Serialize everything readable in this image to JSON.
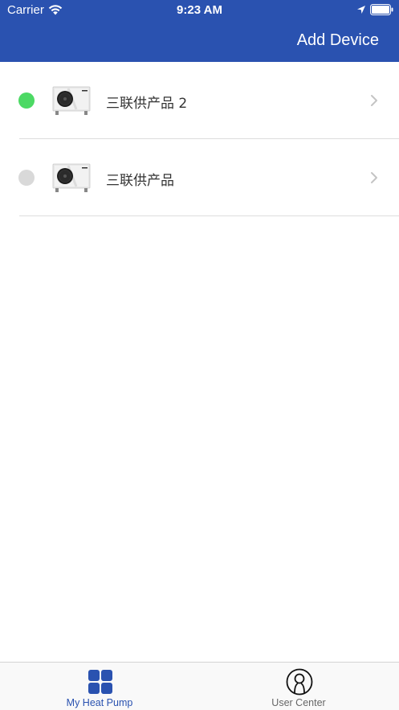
{
  "status_bar": {
    "carrier": "Carrier",
    "time": "9:23 AM"
  },
  "header": {
    "add_device_label": "Add Device",
    "background_color": "#2a52b0"
  },
  "devices": [
    {
      "name": "三联供产品 2",
      "status": "online",
      "status_color": "#4cd964",
      "icon": "heat-pump-unit-image"
    },
    {
      "name": "三联供产品",
      "status": "offline",
      "status_color": "#d9d9d9",
      "icon": "heat-pump-unit-image"
    }
  ],
  "tab_bar": {
    "tabs": [
      {
        "label": "My Heat Pump",
        "icon": "grid-icon",
        "active": true,
        "color": "#2a52b0"
      },
      {
        "label": "User Center",
        "icon": "user-icon",
        "active": false,
        "color": "#666666"
      }
    ]
  }
}
